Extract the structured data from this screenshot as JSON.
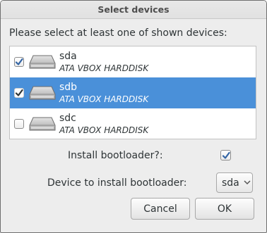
{
  "window": {
    "title": "Select devices"
  },
  "prompt": "Please select at least one of shown devices:",
  "devices": [
    {
      "name": "sda",
      "model": "ATA VBOX HARDDISK",
      "checked": true,
      "selected": false
    },
    {
      "name": "sdb",
      "model": "ATA VBOX HARDDISK",
      "checked": true,
      "selected": true
    },
    {
      "name": "sdc",
      "model": "ATA VBOX HARDDISK",
      "checked": false,
      "selected": false
    }
  ],
  "bootloader": {
    "install_label": "Install bootloader?:",
    "install_checked": true,
    "device_label": "Device to install bootloader:",
    "device_value": "sda"
  },
  "buttons": {
    "cancel": "Cancel",
    "ok": "OK"
  },
  "colors": {
    "selection": "#4a90d9",
    "check": "#3465a4"
  }
}
